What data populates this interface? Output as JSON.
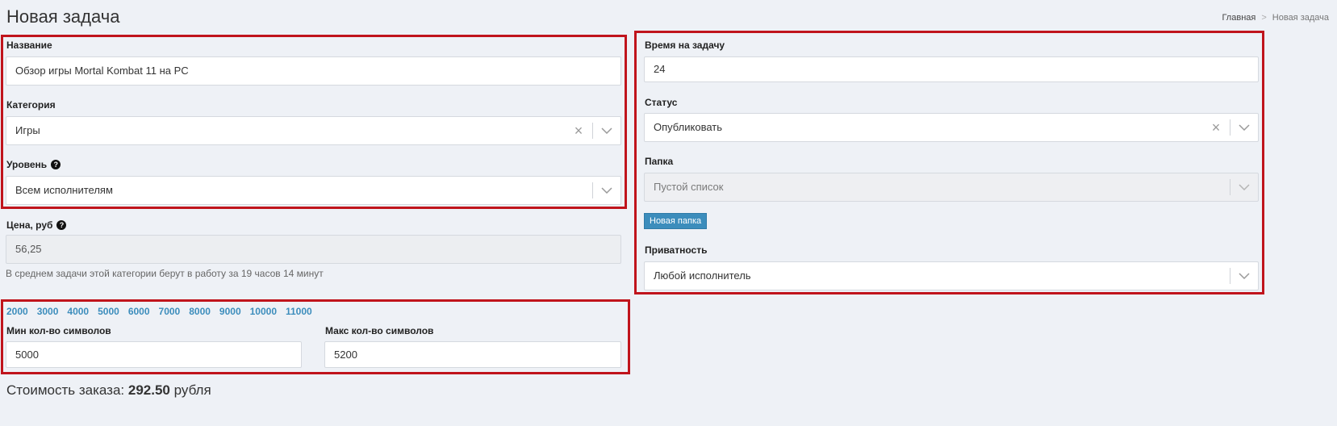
{
  "page": {
    "title": "Новая задача"
  },
  "breadcrumb": {
    "home": "Главная",
    "separator": ">",
    "current": "Новая задача"
  },
  "form": {
    "name": {
      "label": "Название",
      "value": "Обзор игры Mortal Kombat 11 на PC"
    },
    "category": {
      "label": "Категория",
      "value": "Игры"
    },
    "level": {
      "label": "Уровень",
      "value": "Всем исполнителям"
    },
    "price": {
      "label": "Цена, руб",
      "value": "56,25",
      "hint": "В среднем задачи этой категории берут в работу за 19 часов 14 минут"
    },
    "quick_sizes": [
      "2000",
      "3000",
      "4000",
      "5000",
      "6000",
      "7000",
      "8000",
      "9000",
      "10000",
      "11000"
    ],
    "min_chars": {
      "label": "Мин кол-во символов",
      "value": "5000"
    },
    "max_chars": {
      "label": "Макс кол-во символов",
      "value": "5200"
    },
    "time": {
      "label": "Время на задачу",
      "value": "24"
    },
    "status": {
      "label": "Статус",
      "value": "Опубликовать"
    },
    "folder": {
      "label": "Папка",
      "placeholder": "Пустой список",
      "new_folder_button": "Новая папка"
    },
    "privacy": {
      "label": "Приватность",
      "value": "Любой исполнитель"
    }
  },
  "total": {
    "prefix": "Стоимость заказа:",
    "amount": "292.50",
    "suffix": "рубля"
  },
  "icons": {
    "help": "question-circle-icon",
    "clear": "close-icon",
    "dropdown": "chevron-down-icon"
  },
  "colors": {
    "highlight_border": "#c0141c",
    "link": "#3c8dbc",
    "button": "#3c8dbc",
    "background": "#eef1f6"
  }
}
